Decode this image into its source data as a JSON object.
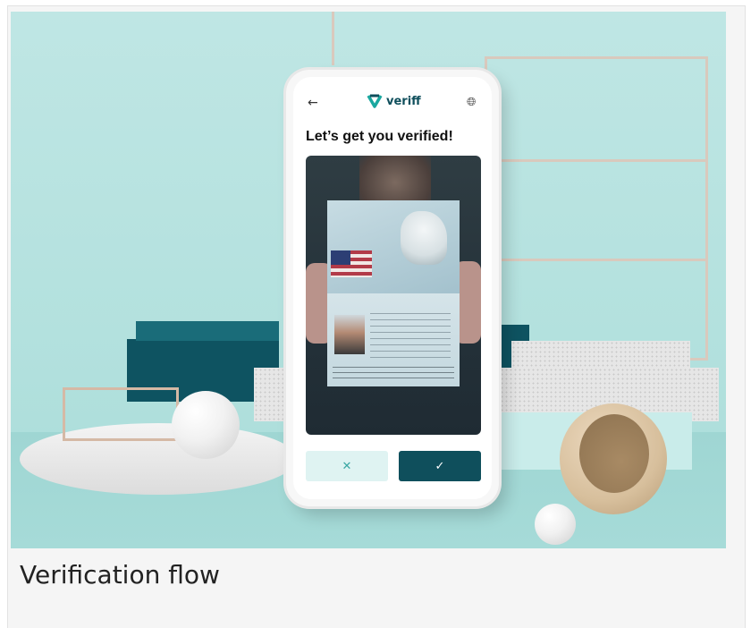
{
  "app": {
    "brand_name": "veriff",
    "screen_heading": "Let’s get you verified!",
    "caption": "Verification flow"
  },
  "icons": {
    "back": "back-arrow-icon",
    "language": "globe-icon",
    "cancel": "close-icon",
    "confirm": "checkmark-icon"
  },
  "colors": {
    "brand": "#0f4f5c",
    "brand_light": "#dff3f2",
    "scene_bg": "#b3e1de"
  }
}
